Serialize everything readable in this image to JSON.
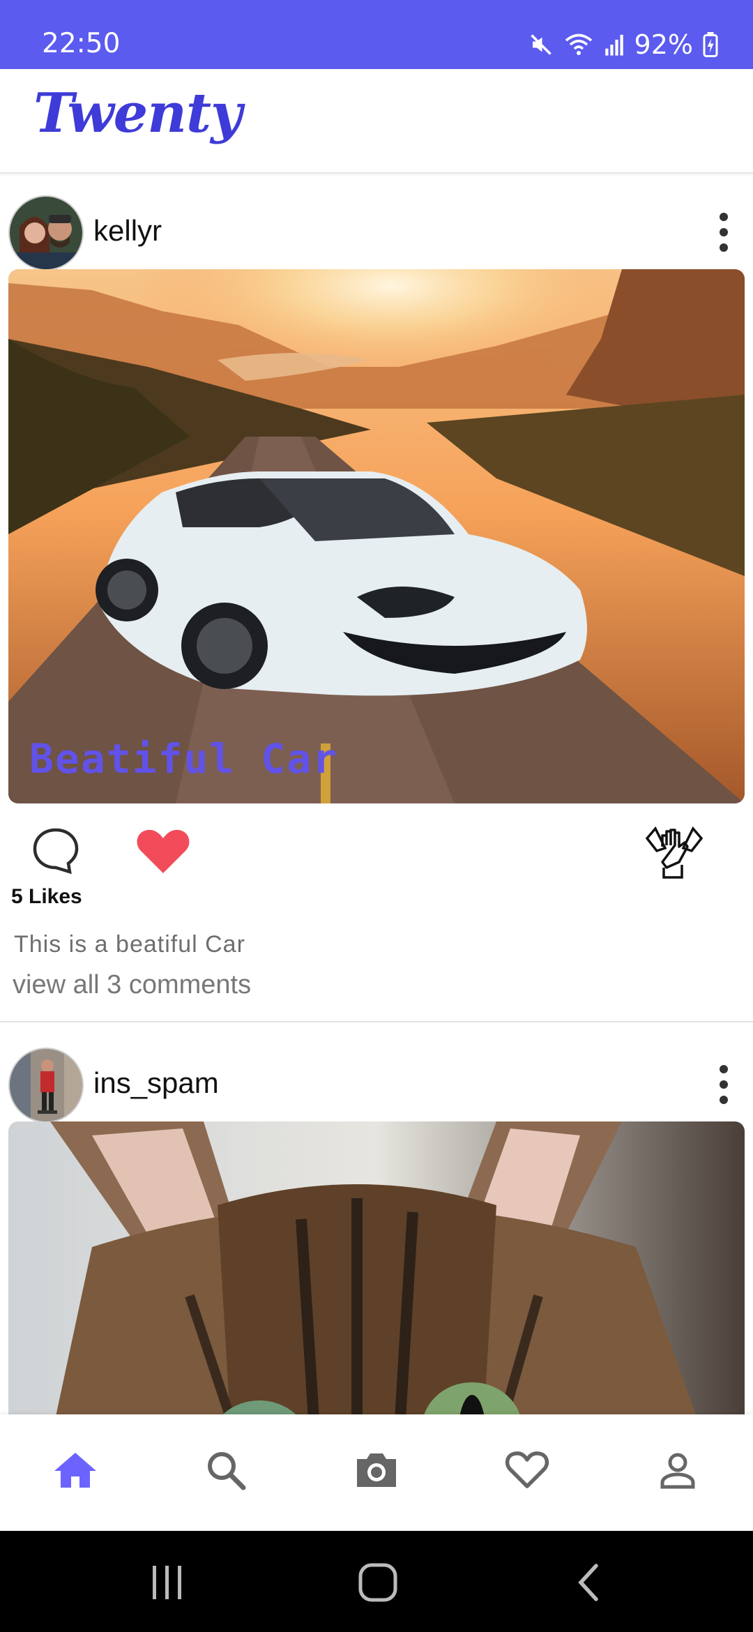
{
  "status_bar": {
    "time": "22:50",
    "battery_percent": "92%",
    "background_color": "#5b5bef"
  },
  "app": {
    "logo_text": "Twenty",
    "accent_color": "#3e3bd8"
  },
  "posts": [
    {
      "username": "kellyr",
      "image_description_icon": "car-photo",
      "image_overlay_text": "Beatiful Car",
      "liked": true,
      "likes": "5 Likes",
      "caption": "This is a beatiful Car",
      "comments_link": "view all 3 comments"
    },
    {
      "username": "ins_spam",
      "image_description_icon": "cat-photo"
    }
  ],
  "bottom_nav": {
    "items": [
      {
        "icon": "home-icon",
        "active": true
      },
      {
        "icon": "search-icon",
        "active": false
      },
      {
        "icon": "camera-icon",
        "active": false
      },
      {
        "icon": "heart-icon",
        "active": false
      },
      {
        "icon": "profile-icon",
        "active": false
      }
    ],
    "active_color": "#6c63ff",
    "inactive_color": "#666666"
  },
  "system_nav": {
    "items": [
      "recents-icon",
      "home-circle-icon",
      "back-icon"
    ]
  }
}
